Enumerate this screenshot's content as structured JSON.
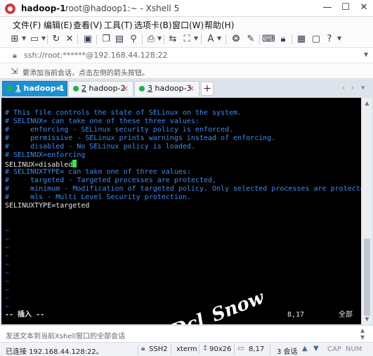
{
  "window": {
    "session_title": "hadoop-1",
    "title_rest": "root@hadoop1:~ - Xshell 5",
    "minimize": "—",
    "maximize": "☐",
    "close": "✕"
  },
  "menu": [
    "文件(F)",
    "编辑(E)",
    "查看(V)",
    "工具(T)",
    "选项卡(B)",
    "窗口(W)",
    "帮助(H)"
  ],
  "address": {
    "text": "ssh://root:******@192.168.44.128:22"
  },
  "hint": {
    "text": "要添加当前会话，点击左侧的箭头按钮。"
  },
  "tabs": [
    {
      "num": "1",
      "name": " hadoop-1",
      "close": "×",
      "active": true
    },
    {
      "num": "2",
      "name": " hadoop-2",
      "close": "×",
      "active": false
    },
    {
      "num": "3",
      "name": " hadoop-3",
      "close": "×",
      "active": false
    }
  ],
  "tab_add": "+",
  "terminal": {
    "lines": [
      {
        "text": "# This file controls the state of SELinux on the system.",
        "color": "blue"
      },
      {
        "text": "# SELINUX= can take one of these three values:",
        "color": "blue"
      },
      {
        "text": "#     enforcing - SELinux security policy is enforced.",
        "color": "blue"
      },
      {
        "text": "#     permissive - SELinux prints warnings instead of enforcing.",
        "color": "blue"
      },
      {
        "text": "#     disabled - No SELinux policy is loaded.",
        "color": "blue"
      },
      {
        "text": "# SELINUX=enforcing",
        "color": "blue"
      },
      {
        "text": "SELINUX=disabled",
        "color": "white"
      },
      {
        "text": "# SELINUXTYPE= can take one of three values:",
        "color": "blue"
      },
      {
        "text": "#     targeted - Targeted processes are protected,",
        "color": "blue"
      },
      {
        "text": "#     minimum - Modification of targeted policy. Only selected processes are protected.",
        "color": "blue"
      },
      {
        "text": "#     mls - Multi Level Security protection.",
        "color": "blue"
      },
      {
        "text": "SELINUXTYPE=targeted",
        "color": "white"
      }
    ],
    "tilde": "~",
    "tilde_count": 11,
    "mode": "-- 插入 --",
    "cursor_pos": "8,17",
    "scope": "全部",
    "watermark": "Dcl_Snow"
  },
  "send_bar": {
    "text": "发送文本到当前Xshell窗口的全部会话"
  },
  "status": {
    "connection": "已连接 192.168.44.128:22。",
    "protocol": "SSH2",
    "terminal": "xterm",
    "size": "90x26",
    "position": "8,17",
    "sessions": "3 会话",
    "cap": "CAP",
    "num": "NUM"
  },
  "colors": {
    "tab_active": "#1a8fd1",
    "tab_dot": "#21b14a",
    "term_comment": "#3c8df0",
    "term_text": "#e8e8e8",
    "term_tilde": "#4a4fe0",
    "cursor": "#36e84e"
  }
}
